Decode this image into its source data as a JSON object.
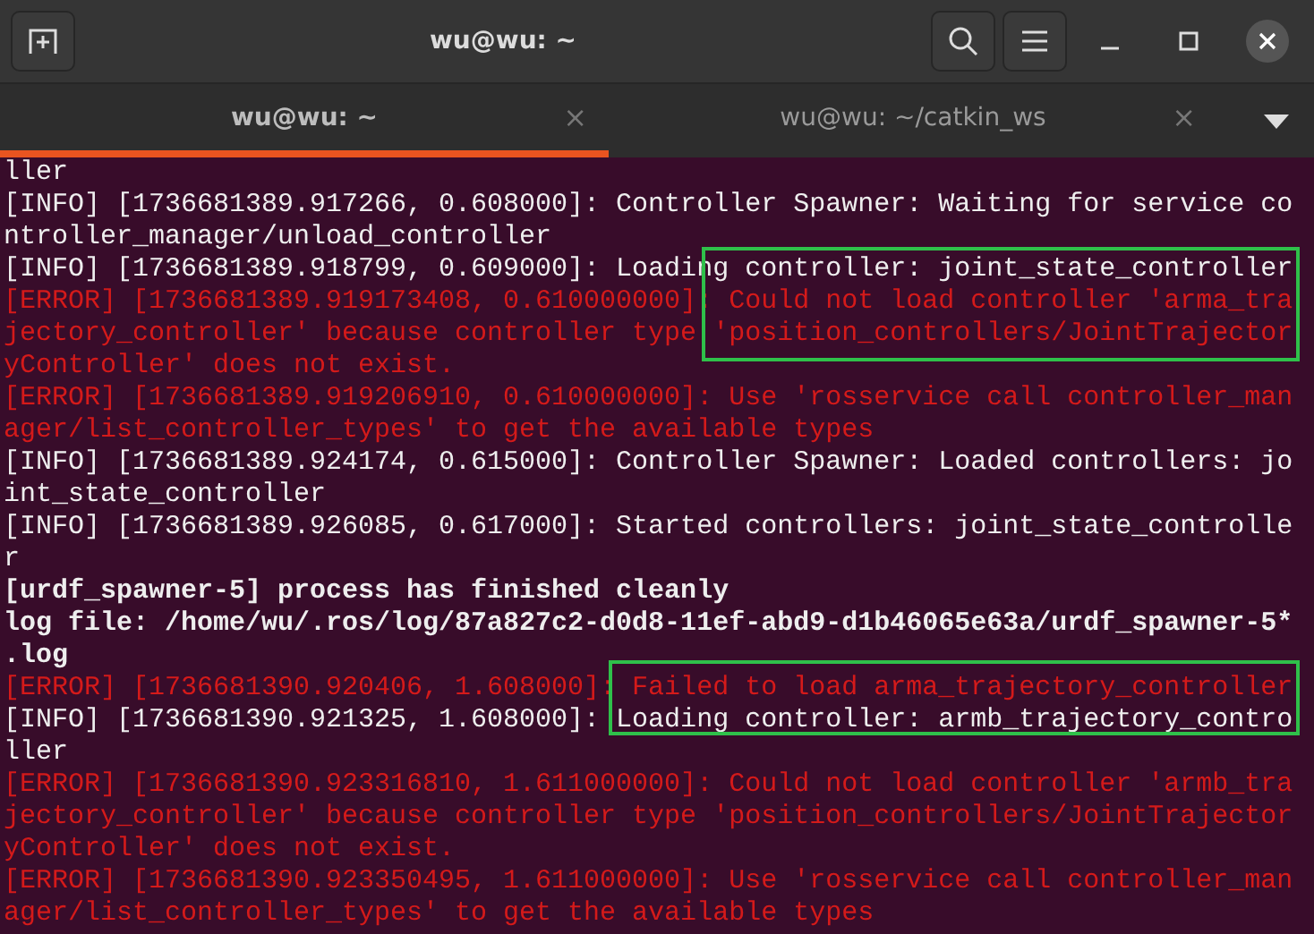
{
  "window": {
    "title": "wu@wu: ~"
  },
  "tabs": [
    {
      "label": "wu@wu: ~",
      "selected": true,
      "close": "×"
    },
    {
      "label": "wu@wu: ~/catkin_ws",
      "selected": false,
      "close": "×"
    }
  ],
  "terminal": {
    "lines": [
      {
        "kind": "info",
        "text": "ller"
      },
      {
        "kind": "info",
        "text": "[INFO] [1736681389.917266, 0.608000]: Controller Spawner: Waiting for service co"
      },
      {
        "kind": "info",
        "text": "ntroller_manager/unload_controller"
      },
      {
        "kind": "info",
        "text": "[INFO] [1736681389.918799, 0.609000]: Loading controller: joint_state_controller"
      },
      {
        "kind": "error",
        "text": "[ERROR] [1736681389.919173408, 0.610000000]: Could not load controller 'arma_tra"
      },
      {
        "kind": "error",
        "text": "jectory_controller' because controller type 'position_controllers/JointTrajector"
      },
      {
        "kind": "error",
        "text": "yController' does not exist."
      },
      {
        "kind": "error",
        "text": "[ERROR] [1736681389.919206910, 0.610000000]: Use 'rosservice call controller_man"
      },
      {
        "kind": "error",
        "text": "ager/list_controller_types' to get the available types"
      },
      {
        "kind": "info",
        "text": "[INFO] [1736681389.924174, 0.615000]: Controller Spawner: Loaded controllers: jo"
      },
      {
        "kind": "info",
        "text": "int_state_controller"
      },
      {
        "kind": "info",
        "text": "[INFO] [1736681389.926085, 0.617000]: Started controllers: joint_state_controlle"
      },
      {
        "kind": "info",
        "text": "r"
      },
      {
        "kind": "bold",
        "text": "[urdf_spawner-5] process has finished cleanly"
      },
      {
        "kind": "bold",
        "text": "log file: /home/wu/.ros/log/87a827c2-d0d8-11ef-abd9-d1b46065e63a/urdf_spawner-5*"
      },
      {
        "kind": "bold",
        "text": ".log"
      },
      {
        "kind": "error",
        "text": "[ERROR] [1736681390.920406, 1.608000]: Failed to load arma_trajectory_controller"
      },
      {
        "kind": "info",
        "text": "[INFO] [1736681390.921325, 1.608000]: Loading controller: armb_trajectory_contro"
      },
      {
        "kind": "info",
        "text": "ller"
      },
      {
        "kind": "error",
        "text": "[ERROR] [1736681390.923316810, 1.611000000]: Could not load controller 'armb_tra"
      },
      {
        "kind": "error",
        "text": "jectory_controller' because controller type 'position_controllers/JointTrajector"
      },
      {
        "kind": "error",
        "text": "yController' does not exist."
      },
      {
        "kind": "error",
        "text": "[ERROR] [1736681390.923350495, 1.611000000]: Use 'rosservice call controller_man"
      },
      {
        "kind": "error",
        "text": "ager/list_controller_types' to get the available types"
      }
    ]
  }
}
